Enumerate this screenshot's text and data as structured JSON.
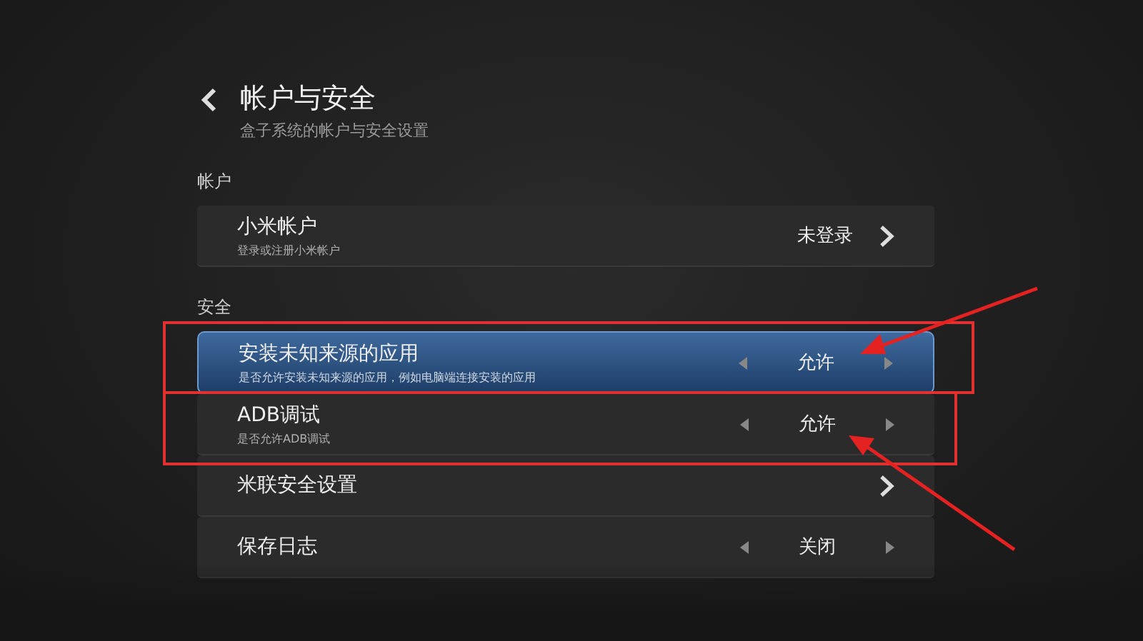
{
  "header": {
    "title": "帐户与安全",
    "subtitle": "盒子系统的帐户与安全设置"
  },
  "sections": [
    {
      "title": "帐户",
      "items": [
        {
          "kind": "link",
          "label": "小米帐户",
          "description": "登录或注册小米帐户",
          "value": "未登录",
          "selected": false
        }
      ]
    },
    {
      "title": "安全",
      "items": [
        {
          "kind": "toggle",
          "label": "安装未知来源的应用",
          "description": "是否允许安装未知来源的应用，例如电脑端连接安装的应用",
          "value": "允许",
          "selected": true
        },
        {
          "kind": "toggle",
          "label": "ADB调试",
          "description": "是否允许ADB调试",
          "value": "允许",
          "selected": false
        },
        {
          "kind": "link",
          "label": "米联安全设置",
          "selected": false
        },
        {
          "kind": "toggle",
          "label": "保存日志",
          "value": "关闭",
          "selected": false
        }
      ]
    }
  ]
}
